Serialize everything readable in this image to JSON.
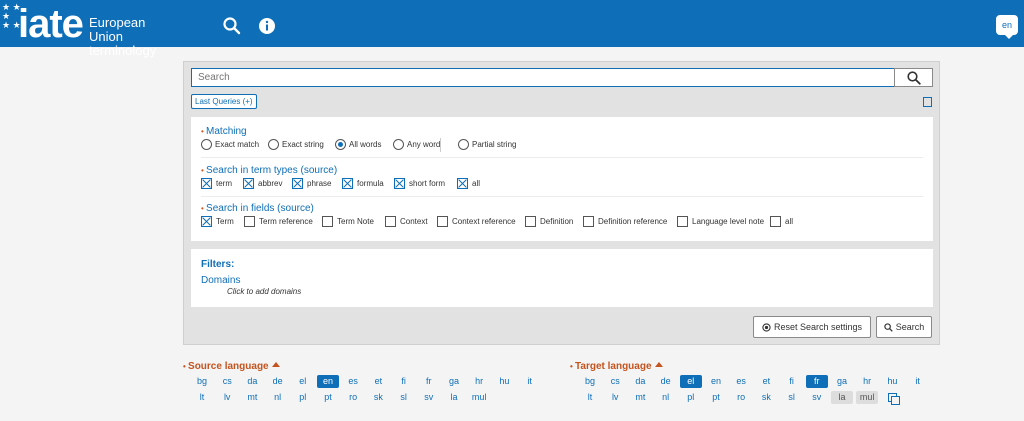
{
  "header": {
    "logo_text": "iate",
    "logo_sub1": "European Union",
    "logo_sub2": "terminology",
    "search_icon": "search-icon",
    "info_icon": "info-icon",
    "lang_code": "en",
    "brand_color": "#0e6fb8"
  },
  "search": {
    "placeholder": "Search",
    "last_queries": "Last Queries (+)"
  },
  "matching": {
    "title": "Matching",
    "options": [
      "Exact match",
      "Exact string",
      "All words",
      "Any word",
      "Partial string"
    ],
    "selected": "All words"
  },
  "term_types": {
    "title": "Search in term types (source)",
    "options": [
      "term",
      "abbrev",
      "phrase",
      "formula",
      "short form",
      "all"
    ],
    "checked": [
      true,
      true,
      true,
      true,
      true,
      true
    ]
  },
  "fields": {
    "title": "Search in fields (source)",
    "options": [
      "Term",
      "Term reference",
      "Term Note",
      "Context",
      "Context reference",
      "Definition",
      "Definition reference",
      "Language level note",
      "all"
    ],
    "checked": [
      true,
      false,
      false,
      false,
      false,
      false,
      false,
      false,
      false
    ]
  },
  "filters": {
    "title": "Filters:",
    "domains": "Domains",
    "hint": "Click to add domains"
  },
  "buttons": {
    "reset": "Reset Search settings",
    "search": "Search"
  },
  "source_language": {
    "title": "Source language",
    "row1": [
      "bg",
      "cs",
      "da",
      "de",
      "el",
      "en",
      "es",
      "et",
      "fi",
      "fr",
      "ga",
      "hr",
      "hu",
      "it"
    ],
    "row2": [
      "lt",
      "lv",
      "mt",
      "nl",
      "pl",
      "pt",
      "ro",
      "sk",
      "sl",
      "sv",
      "la",
      "mul"
    ],
    "selected": [
      "en"
    ]
  },
  "target_language": {
    "title": "Target language",
    "row1": [
      "bg",
      "cs",
      "da",
      "de",
      "el",
      "en",
      "es",
      "et",
      "fi",
      "fr",
      "ga",
      "hr",
      "hu",
      "it"
    ],
    "row2": [
      "lt",
      "lv",
      "mt",
      "nl",
      "pl",
      "pt",
      "ro",
      "sk",
      "sl",
      "sv",
      "la",
      "mul"
    ],
    "selected": [
      "el",
      "fr"
    ],
    "greyed": [
      "la",
      "mul"
    ]
  }
}
